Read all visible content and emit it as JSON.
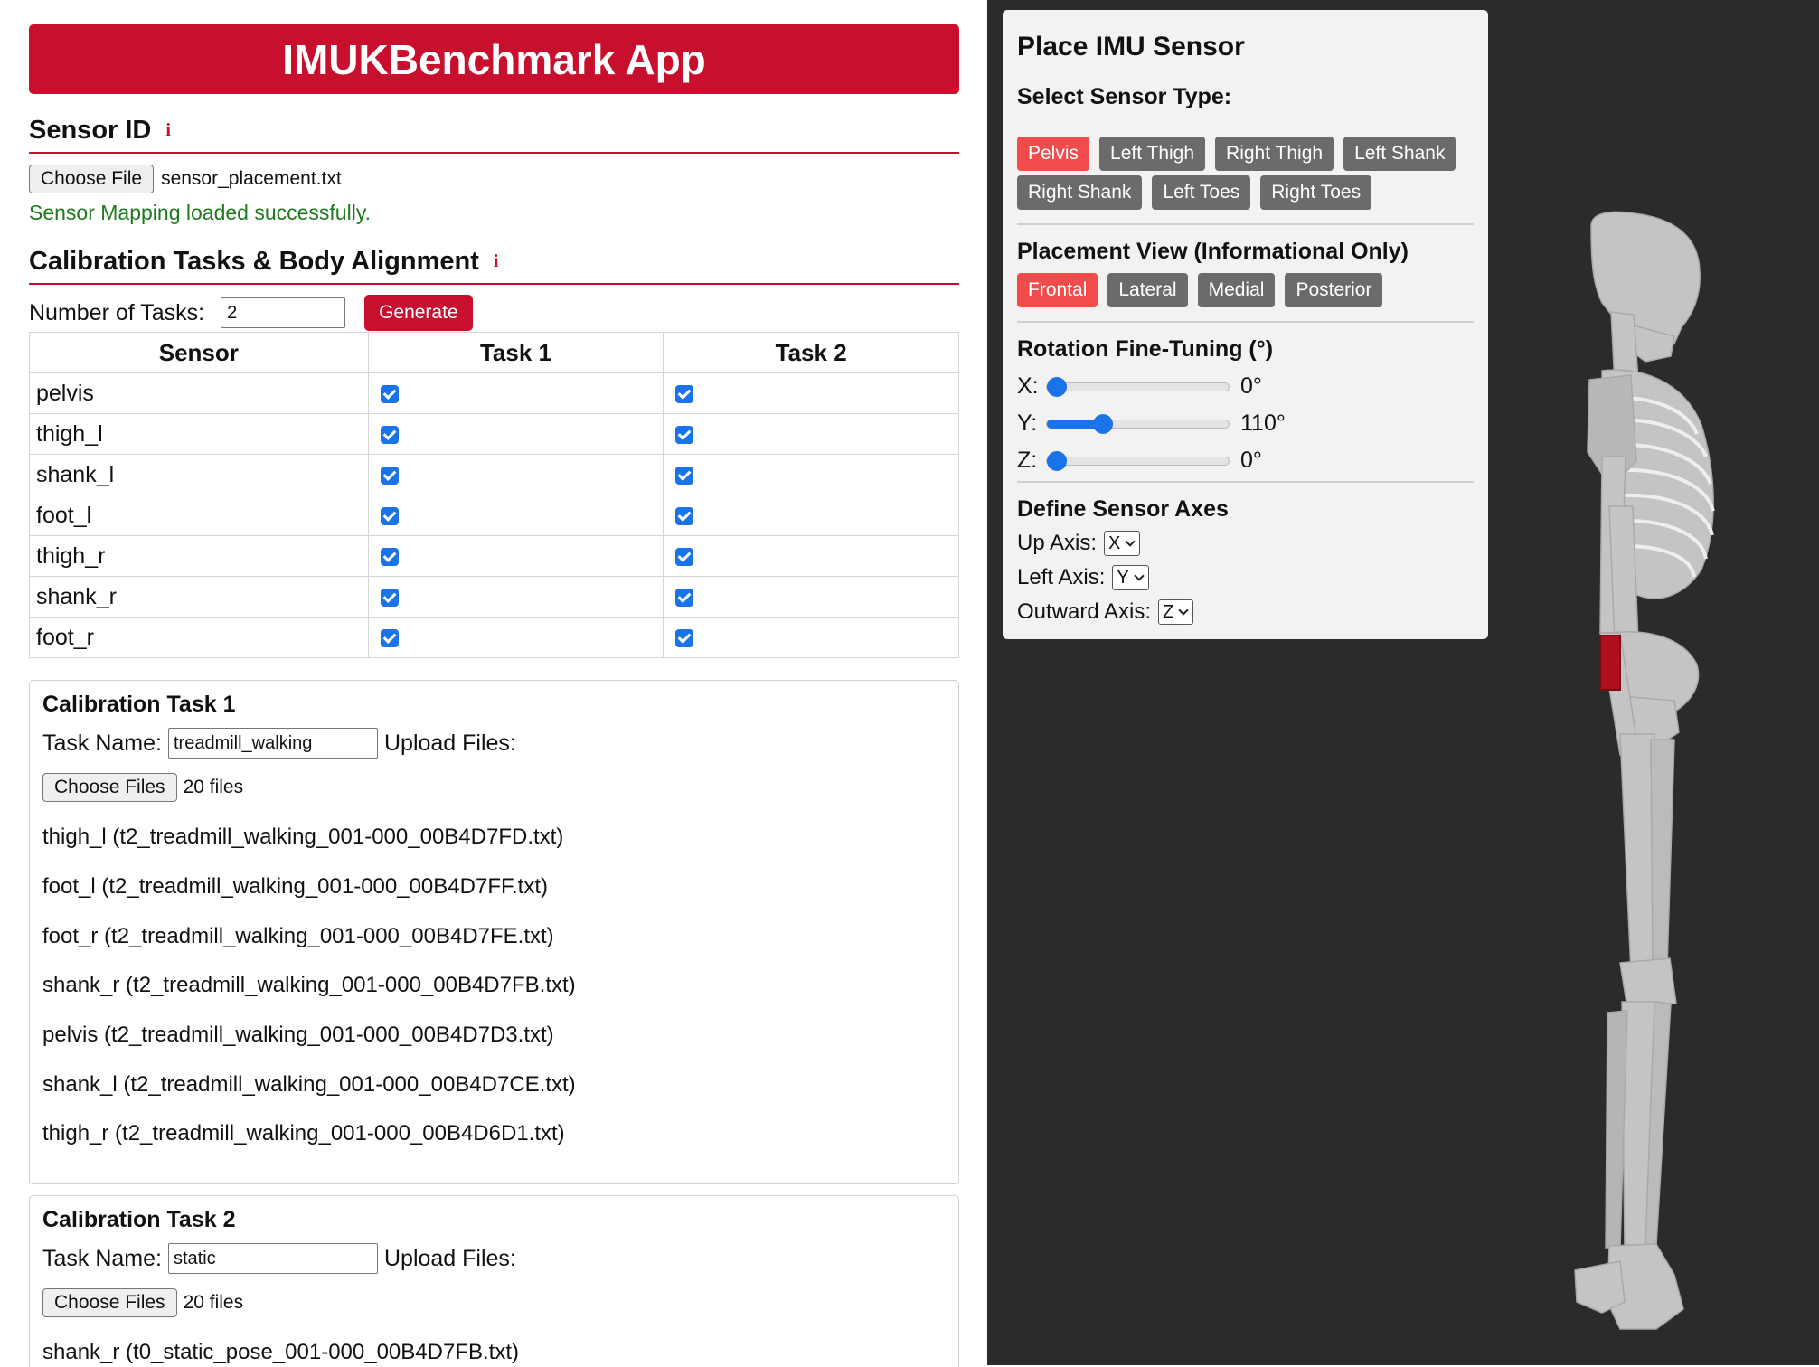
{
  "app": {
    "title": "IMUKBenchmark App"
  },
  "sensor_id": {
    "title": "Sensor ID",
    "info": "i",
    "choose_file_label": "Choose File",
    "file_name": "sensor_placement.txt",
    "status": "Sensor Mapping loaded successfully."
  },
  "calibration": {
    "title": "Calibration Tasks & Body Alignment",
    "info": "i",
    "num_tasks_label": "Number of Tasks:",
    "num_tasks_value": "2",
    "generate_label": "Generate",
    "table": {
      "headers": [
        "Sensor",
        "Task 1",
        "Task 2"
      ],
      "rows": [
        {
          "sensor": "pelvis",
          "task1": true,
          "task2": true
        },
        {
          "sensor": "thigh_l",
          "task1": true,
          "task2": true
        },
        {
          "sensor": "shank_l",
          "task1": true,
          "task2": true
        },
        {
          "sensor": "foot_l",
          "task1": true,
          "task2": true
        },
        {
          "sensor": "thigh_r",
          "task1": true,
          "task2": true
        },
        {
          "sensor": "shank_r",
          "task1": true,
          "task2": true
        },
        {
          "sensor": "foot_r",
          "task1": true,
          "task2": true
        }
      ]
    }
  },
  "tasks": [
    {
      "title": "Calibration Task 1",
      "task_name_label": "Task Name:",
      "task_name_value": "treadmill_walking",
      "upload_label": "Upload Files:",
      "choose_files_label": "Choose Files",
      "files_count": "20 files",
      "files": [
        "thigh_l (t2_treadmill_walking_001-000_00B4D7FD.txt)",
        "foot_l (t2_treadmill_walking_001-000_00B4D7FF.txt)",
        "foot_r (t2_treadmill_walking_001-000_00B4D7FE.txt)",
        "shank_r (t2_treadmill_walking_001-000_00B4D7FB.txt)",
        "pelvis (t2_treadmill_walking_001-000_00B4D7D3.txt)",
        "shank_l (t2_treadmill_walking_001-000_00B4D7CE.txt)",
        "thigh_r (t2_treadmill_walking_001-000_00B4D6D1.txt)"
      ]
    },
    {
      "title": "Calibration Task 2",
      "task_name_label": "Task Name:",
      "task_name_value": "static",
      "upload_label": "Upload Files:",
      "choose_files_label": "Choose Files",
      "files_count": "20 files",
      "files": [
        "shank_r (t0_static_pose_001-000_00B4D7FB.txt)"
      ]
    }
  ],
  "imu_panel": {
    "title": "Place IMU Sensor",
    "sensor_type_label": "Select Sensor Type:",
    "sensor_types": [
      {
        "label": "Pelvis",
        "active": true
      },
      {
        "label": "Left Thigh",
        "active": false
      },
      {
        "label": "Right Thigh",
        "active": false
      },
      {
        "label": "Left Shank",
        "active": false
      },
      {
        "label": "Right Shank",
        "active": false
      },
      {
        "label": "Left Toes",
        "active": false
      },
      {
        "label": "Right Toes",
        "active": false
      }
    ],
    "placement_view_label": "Placement View (Informational Only)",
    "views": [
      {
        "label": "Frontal",
        "active": true
      },
      {
        "label": "Lateral",
        "active": false
      },
      {
        "label": "Medial",
        "active": false
      },
      {
        "label": "Posterior",
        "active": false
      }
    ],
    "rotation_label": "Rotation Fine-Tuning (°)",
    "rotations": [
      {
        "axis": "X:",
        "value_text": "0°",
        "fraction": 0.0
      },
      {
        "axis": "Y:",
        "value_text": "110°",
        "fraction": 0.3056
      },
      {
        "axis": "Z:",
        "value_text": "0°",
        "fraction": 0.0
      }
    ],
    "axes_label": "Define Sensor Axes",
    "axes": [
      {
        "label": "Up Axis:",
        "value": "X"
      },
      {
        "label": "Left Axis:",
        "value": "Y"
      },
      {
        "label": "Outward Axis:",
        "value": "Z"
      }
    ]
  },
  "colors": {
    "brand_red": "#c8102e",
    "active_pill": "#f24b4b",
    "inactive_pill": "#6b6b6b",
    "success_green": "#1d7a1d",
    "viewport_bg": "#2b2b2b",
    "sensor_marker": "#b0101e"
  },
  "icons": {
    "info": "info-icon",
    "checkbox": "checkbox-checked-icon",
    "select": "chevron-down-icon"
  }
}
